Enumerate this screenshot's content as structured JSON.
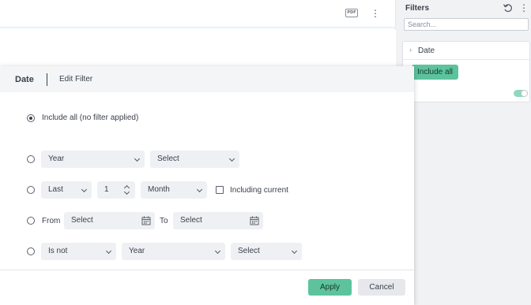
{
  "main": {
    "pdf_label": "PDF",
    "more_icon": "kebab-icon"
  },
  "panel": {
    "title": "Filters",
    "search_placeholder": "Search...",
    "filter_name": "Date",
    "chip": "Include all",
    "toggle_on": true
  },
  "dialog": {
    "title": "Date",
    "subtitle": "Edit Filter",
    "option_include_all": "Include all (no filter applied)",
    "row_year": {
      "granularity": "Year",
      "value": "Select"
    },
    "row_last": {
      "mode": "Last",
      "count": "1",
      "unit": "Month",
      "including_current": "Including current"
    },
    "row_range": {
      "from_label": "From",
      "from_placeholder": "Select",
      "to_label": "To",
      "to_placeholder": "Select"
    },
    "row_isnot": {
      "operator": "Is not",
      "granularity": "Year",
      "value": "Select"
    },
    "apply": "Apply",
    "cancel": "Cancel"
  },
  "colors": {
    "accent": "#5cc39d",
    "text": "#3a3f4b",
    "field_bg": "#eef0f3"
  }
}
